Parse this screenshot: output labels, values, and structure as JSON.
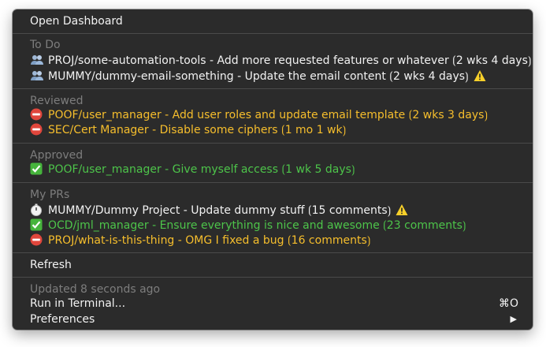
{
  "menu": {
    "open_dashboard": "Open Dashboard",
    "todo": {
      "header": "To Do",
      "items": [
        {
          "icon": "people-icon",
          "text": "PROJ/some-automation-tools - Add more requested features or whatever ⟮2 wks 4 days⟯",
          "warning": false
        },
        {
          "icon": "people-icon",
          "text": "MUMMY/dummy-email-something - Update the email content ⟮2 wks 4 days⟯",
          "warning": true
        }
      ]
    },
    "reviewed": {
      "header": "Reviewed",
      "items": [
        {
          "icon": "no-entry-icon",
          "text": "POOF/user_manager - Add user roles and update email template ⟮2 wks 3 days⟯",
          "color": "#f6be2c"
        },
        {
          "icon": "no-entry-icon",
          "text": "SEC/Cert Manager - Disable some ciphers ⟮1 mo 1 wk⟯",
          "color": "#f6be2c"
        }
      ]
    },
    "approved": {
      "header": "Approved",
      "items": [
        {
          "icon": "check-icon",
          "text": "POOF/user_manager - Give myself access ⟮1 wk 5 days⟯",
          "color": "#4dc44a"
        }
      ]
    },
    "my_prs": {
      "header": "My PRs",
      "items": [
        {
          "icon": "stopwatch-icon",
          "text": "MUMMY/Dummy Project - Update dummy stuff ⟮15 comments⟯",
          "warning": true
        },
        {
          "icon": "check-icon",
          "text": "OCD/jml_manager - Ensure everything is nice and awesome ⟮23 comments⟯",
          "color": "#4dc44a"
        },
        {
          "icon": "no-entry-icon",
          "text": "PROJ/what-is-this-thing - OMG I fixed a bug ⟮16 comments⟯",
          "color": "#f6be2c"
        }
      ]
    },
    "refresh": "Refresh",
    "updated": "Updated 8 seconds ago",
    "run_in_terminal": "Run in Terminal...",
    "run_shortcut": "⌘O",
    "preferences": "Preferences",
    "preferences_arrow": "▶"
  }
}
